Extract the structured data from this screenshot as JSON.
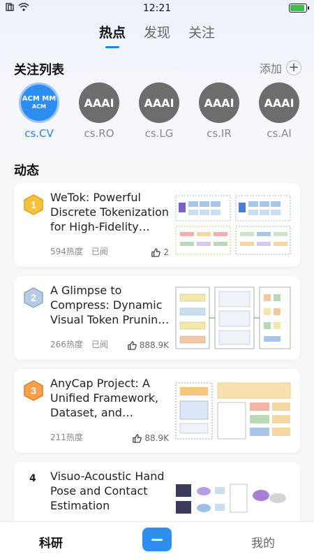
{
  "status": {
    "time": "12:21"
  },
  "tabs": [
    {
      "label": "热点"
    },
    {
      "label": "发现"
    },
    {
      "label": "关注"
    }
  ],
  "follow": {
    "title": "关注列表",
    "add_label": "添加",
    "items": [
      {
        "badge": "ACM MM",
        "badge_sub": "ACM",
        "label": "cs.CV"
      },
      {
        "badge": "AAAI",
        "label": "cs.RO"
      },
      {
        "badge": "AAAI",
        "label": "cs.LG"
      },
      {
        "badge": "AAAI",
        "label": "cs.IR"
      },
      {
        "badge": "AAAI",
        "label": "cs.AI"
      }
    ]
  },
  "feed": {
    "title": "动态",
    "items": [
      {
        "rank": "1",
        "title": "WeTok: Powerful Discrete Tokenization for High-Fidelity Visual Reconstruction",
        "heat": "594热度",
        "read": "已阅",
        "likes": "2"
      },
      {
        "rank": "2",
        "title": "A Glimpse to Compress: Dynamic Visual Token Pruning for Large Vision-Language Models",
        "heat": "266热度",
        "read": "已阅",
        "likes": "888.9K"
      },
      {
        "rank": "3",
        "title": "AnyCap Project: A Unified Framework, Dataset, and Benchmark",
        "heat": "211热度",
        "read": "",
        "likes": "88.9K"
      },
      {
        "rank": "4",
        "title": "Visuo-Acoustic Hand Pose and Contact Estimation",
        "heat": "",
        "read": "",
        "likes": ""
      }
    ]
  },
  "nav": {
    "research": "科研",
    "mine": "我的"
  },
  "colors": {
    "accent": "#2b7cf6",
    "gold": "#f2b21b",
    "silver": "#8ea6c9",
    "bronze": "#ef8c2a"
  }
}
